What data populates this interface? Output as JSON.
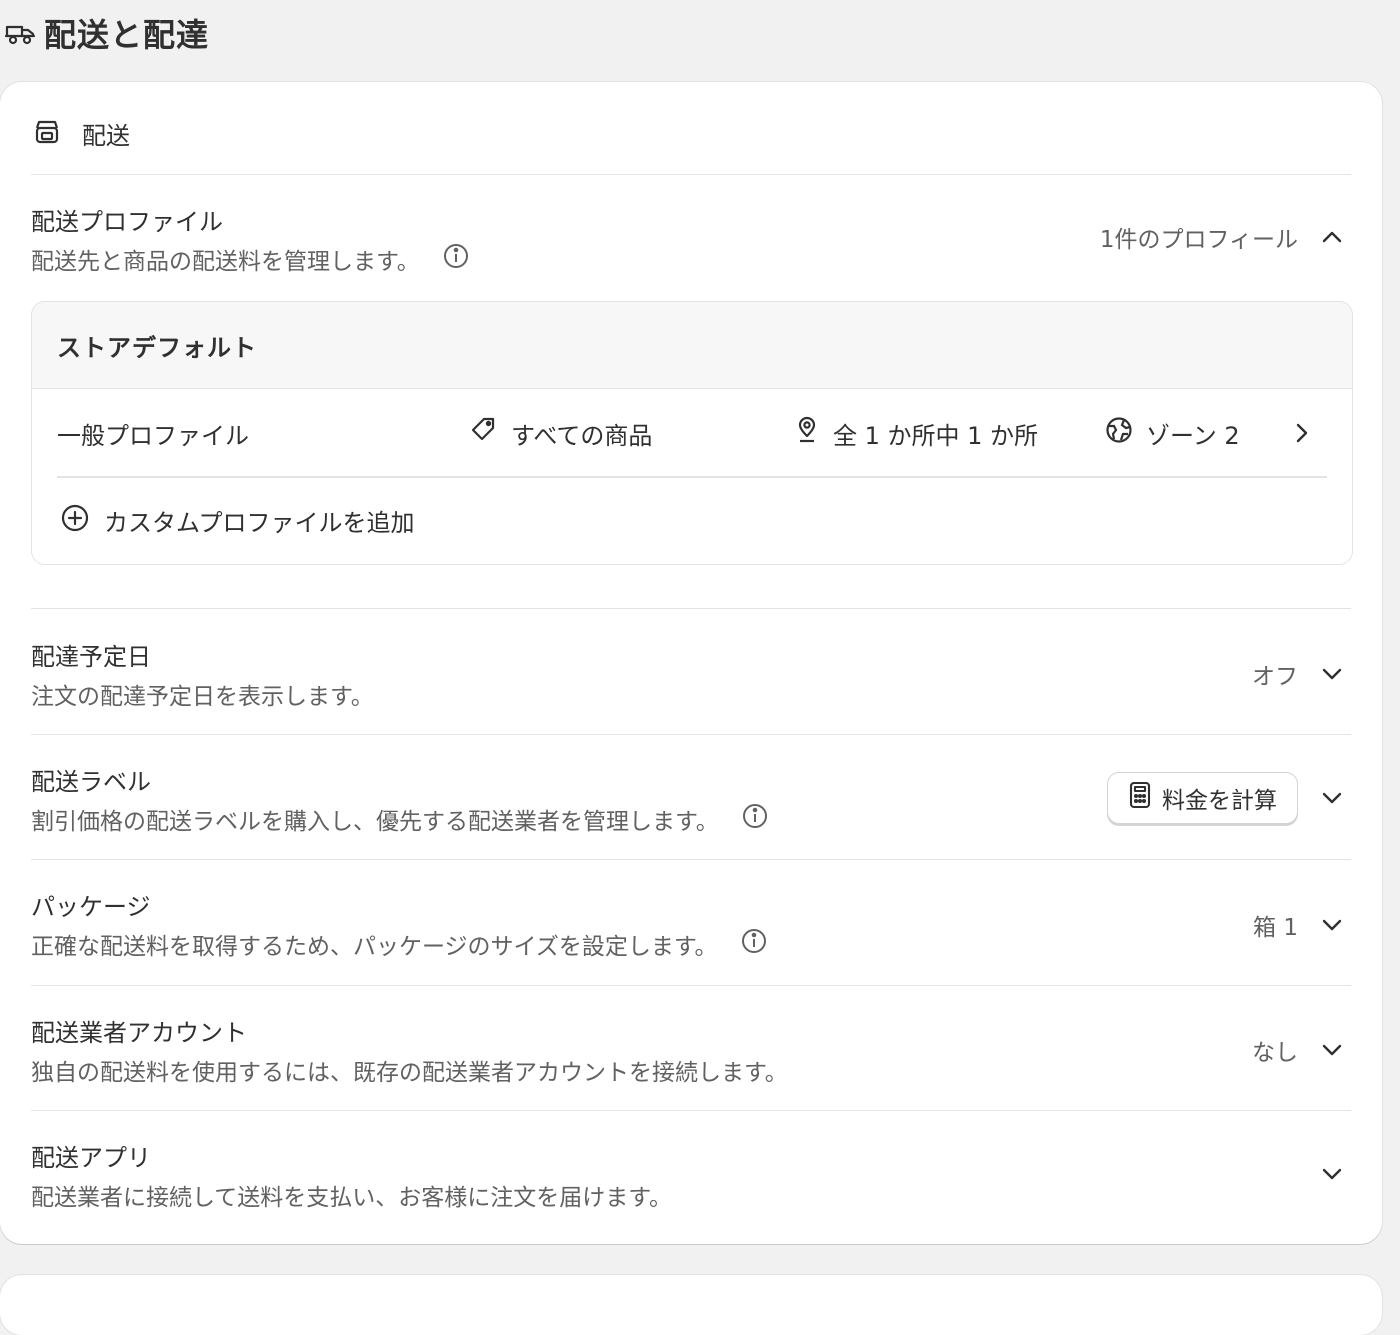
{
  "page": {
    "title": "配送と配達"
  },
  "card": {
    "header_label": "配送",
    "profiles": {
      "title": "配送プロファイル",
      "desc": "配送先と商品の配送料を管理します。",
      "summary": "1件のプロフィール",
      "group_title": "ストアデフォルト",
      "row": {
        "name": "一般プロファイル",
        "products": "すべての商品",
        "locations": "全 1 か所中 1 か所",
        "zones": "ゾーン 2"
      },
      "add_label": "カスタムプロファイルを追加"
    },
    "sections": [
      {
        "title": "配達予定日",
        "desc": "注文の配達予定日を表示します。",
        "value": "オフ"
      },
      {
        "title": "配送ラベル",
        "desc": "割引価格の配送ラベルを購入し、優先する配送業者を管理します。",
        "button": "料金を計算"
      },
      {
        "title": "パッケージ",
        "desc": "正確な配送料を取得するため、パッケージのサイズを設定します。",
        "value": "箱 1"
      },
      {
        "title": "配送業者アカウント",
        "desc": "独自の配送料を使用するには、既存の配送業者アカウントを接続します。",
        "value": "なし"
      },
      {
        "title": "配送アプリ",
        "desc": "配送業者に接続して送料を支払い、お客様に注文を届けます。",
        "value": ""
      }
    ]
  }
}
